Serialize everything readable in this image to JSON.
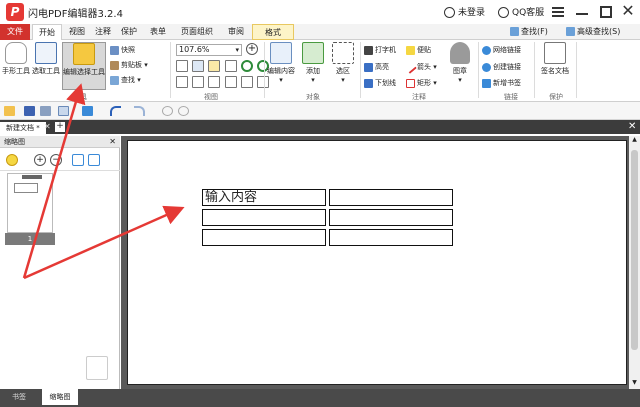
{
  "title_bar": {
    "logo_letter": "P",
    "title": "闪电PDF编辑器3.2.4",
    "user": "未登录",
    "support": "QQ客服"
  },
  "ribbon_tabs": [
    "文件",
    "开始",
    "视图",
    "注释",
    "保护",
    "表单",
    "页面组织",
    "审阅",
    "格式"
  ],
  "ribbon_right": {
    "find": "查找(F)",
    "advanced_find": "高级查找(S)"
  },
  "ribbon": {
    "tools": {
      "hand": "手形工具",
      "select": "选取工具",
      "edit_select": "编辑选择工具",
      "label": "工具"
    },
    "clipboard": {
      "screenshot": "快照",
      "paste": "剪贴板",
      "find": "查找"
    },
    "view": {
      "zoom": "107.6%",
      "label": "视图"
    },
    "object": {
      "edit_content": "编辑内容",
      "add": "添加",
      "select_area": "选区",
      "label": "对象"
    },
    "comment": {
      "typewriter": "打字机",
      "highlight": "高亮",
      "underline": "下划线",
      "note": "便贴",
      "arrow": "箭头",
      "rect": "矩形",
      "stamp": "图章",
      "label": "注释"
    },
    "links": {
      "web_link": "网络链接",
      "create_link": "创建链接",
      "new_bookmark": "新增书签",
      "label": "链接"
    },
    "protect": {
      "sign": "签名文档",
      "label": "保护"
    }
  },
  "doc_tab": {
    "name": "新建文档 *"
  },
  "left_panel": {
    "title": "缩略图",
    "page_number": "1"
  },
  "bottom_tabs": {
    "bookmarks": "书签",
    "thumbnails": "缩略图"
  },
  "document": {
    "table": [
      [
        "输入内容",
        ""
      ],
      [
        "",
        ""
      ],
      [
        "",
        ""
      ]
    ]
  },
  "colors": {
    "accent": "#d2322d",
    "format_tab": "#fdf4c8",
    "annotation_arrow": "#e53935"
  }
}
